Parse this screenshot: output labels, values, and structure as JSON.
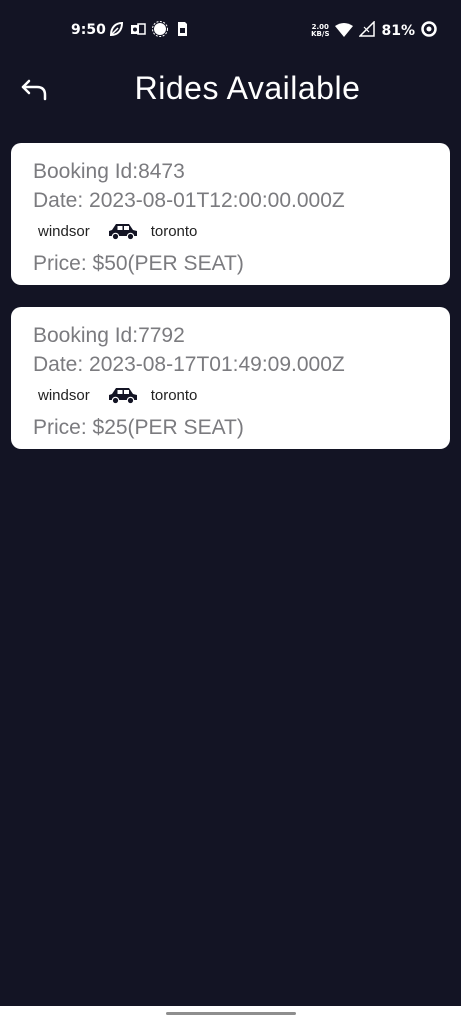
{
  "status_bar": {
    "time": "9:50",
    "net_speed_value": "2.00",
    "net_speed_unit": "KB/S",
    "battery": "81%",
    "icons": [
      "leaf-icon",
      "outlook-icon",
      "settings-icon",
      "sim-icon",
      "wifi-icon",
      "signal-icon",
      "battery-icon"
    ]
  },
  "header": {
    "title": "Rides Available",
    "back_icon": "back-arrow-icon"
  },
  "rides": [
    {
      "booking_id": "Booking Id:8473",
      "date": "Date: 2023-08-01T12:00:00.000Z",
      "from": "windsor",
      "to": "toronto",
      "price": "Price: $50(PER SEAT)"
    },
    {
      "booking_id": "Booking Id:7792",
      "date": "Date: 2023-08-17T01:49:09.000Z",
      "from": "windsor",
      "to": "toronto",
      "price": "Price: $25(PER SEAT)"
    }
  ],
  "colors": {
    "background": "#131424",
    "card": "#ffffff",
    "card_text": "#7b7b7f",
    "city_text": "#222222"
  }
}
